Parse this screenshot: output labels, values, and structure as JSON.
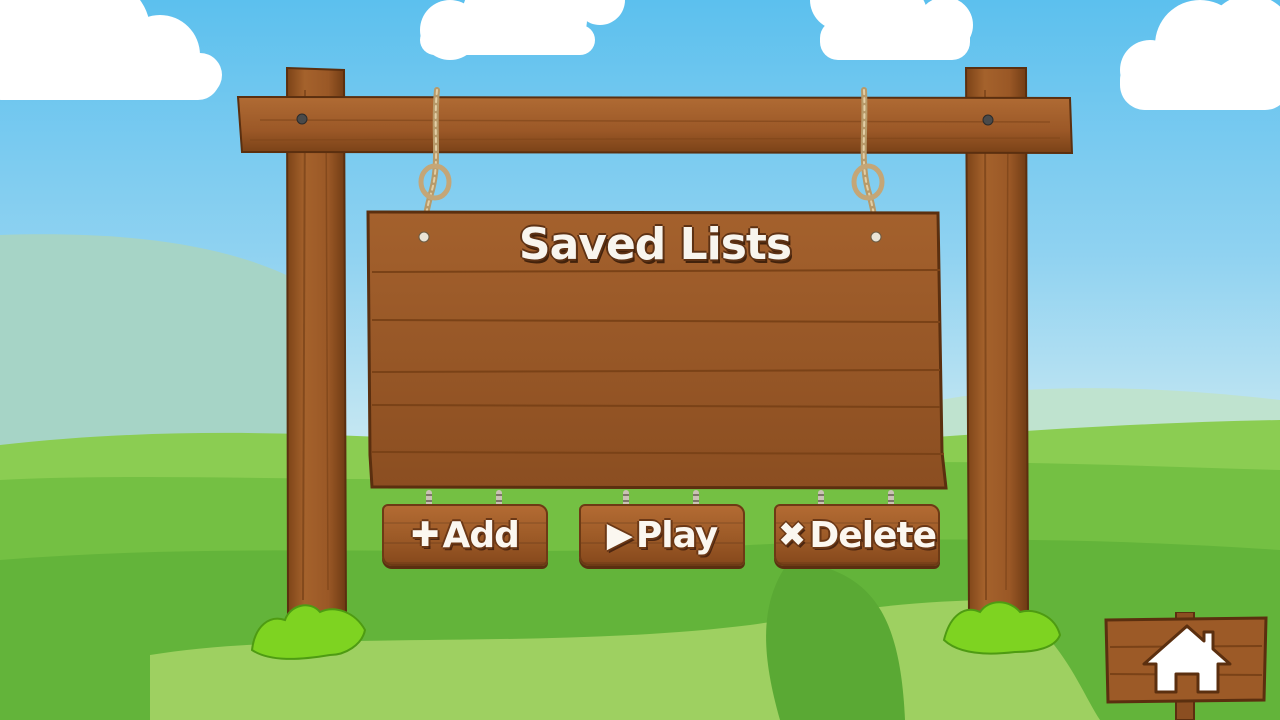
{
  "screen": {
    "title": "Saved Lists"
  },
  "buttons": {
    "add": {
      "glyph": "✚",
      "label": "Add"
    },
    "play": {
      "glyph": "▶",
      "label": "Play"
    },
    "delete": {
      "glyph": "✖",
      "label": "Delete"
    }
  },
  "saved_lists": [],
  "icons": {
    "home": "home-icon"
  },
  "colors": {
    "wood": "#9c5a27",
    "wood_dark": "#6d3a15",
    "grass": "#5fb43a",
    "sky": "#5cc0ee",
    "text": "#f8f5ee"
  }
}
